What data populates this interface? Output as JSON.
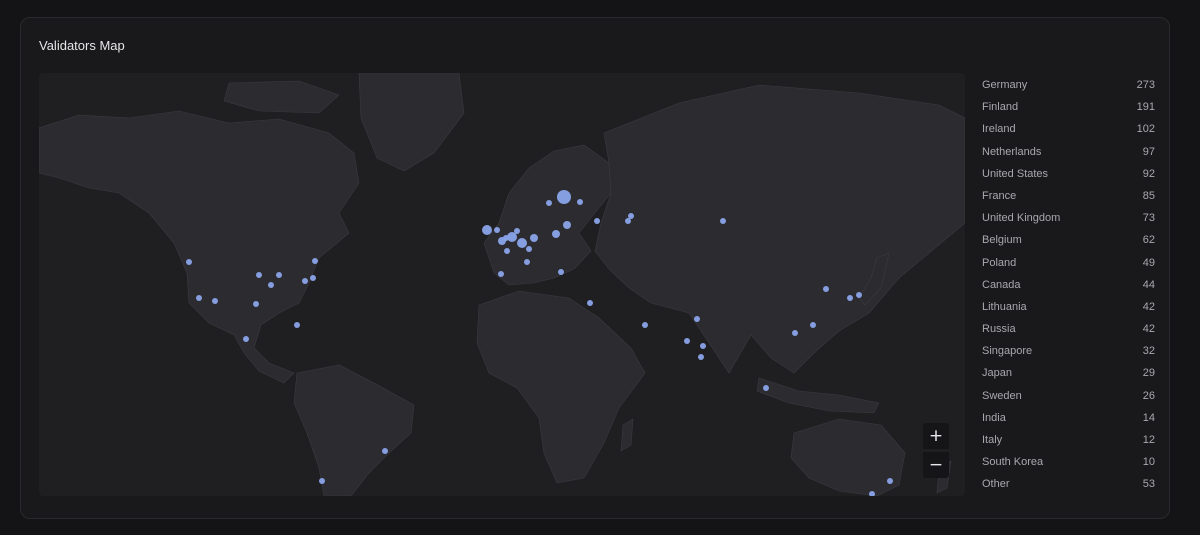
{
  "card": {
    "title": "Validators Map"
  },
  "map": {
    "zoom_in_label": "+",
    "zoom_out_label": "−",
    "marker_color": "#8aa4ea",
    "land_color": "#2b2b30"
  },
  "countries": [
    {
      "name": "Germany",
      "count": "273"
    },
    {
      "name": "Finland",
      "count": "191"
    },
    {
      "name": "Ireland",
      "count": "102"
    },
    {
      "name": "Netherlands",
      "count": "97"
    },
    {
      "name": "United States",
      "count": "92"
    },
    {
      "name": "France",
      "count": "85"
    },
    {
      "name": "United Kingdom",
      "count": "73"
    },
    {
      "name": "Belgium",
      "count": "62"
    },
    {
      "name": "Poland",
      "count": "49"
    },
    {
      "name": "Canada",
      "count": "44"
    },
    {
      "name": "Lithuania",
      "count": "42"
    },
    {
      "name": "Russia",
      "count": "42"
    },
    {
      "name": "Singapore",
      "count": "32"
    },
    {
      "name": "Japan",
      "count": "29"
    },
    {
      "name": "Sweden",
      "count": "26"
    },
    {
      "name": "India",
      "count": "14"
    },
    {
      "name": "Italy",
      "count": "12"
    },
    {
      "name": "South Korea",
      "count": "10"
    },
    {
      "name": "Other",
      "count": "53"
    }
  ]
}
